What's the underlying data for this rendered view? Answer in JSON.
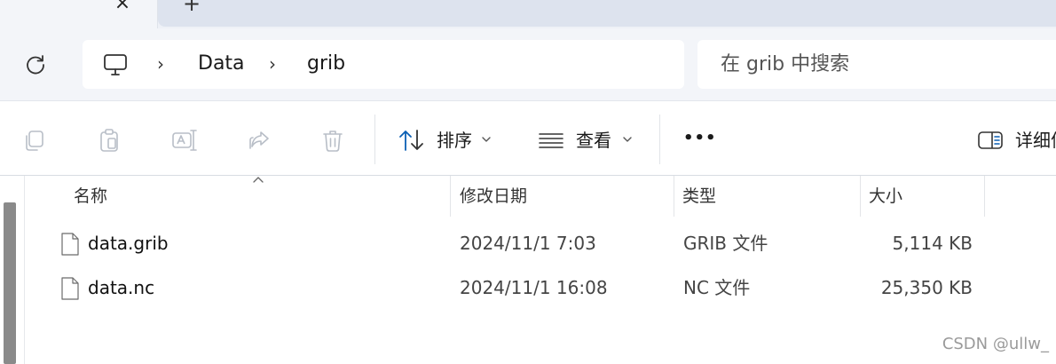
{
  "tabs": {
    "close_glyph": "×",
    "new_tab_glyph": "+"
  },
  "address_bar": {
    "breadcrumbs": [
      {
        "label": "Data"
      },
      {
        "label": "grib"
      }
    ],
    "separator_glyph": "›"
  },
  "search": {
    "placeholder": "在 grib 中搜索"
  },
  "toolbar": {
    "sort_label": "排序",
    "view_label": "查看",
    "more_label": "•••",
    "details_label": "详细信"
  },
  "columns": {
    "name": "名称",
    "date_modified": "修改日期",
    "type": "类型",
    "size": "大小"
  },
  "files": [
    {
      "name": "data.grib",
      "date": "2024/11/1 7:03",
      "type": "GRIB 文件",
      "size": "5,114 KB"
    },
    {
      "name": "data.nc",
      "date": "2024/11/1 16:08",
      "type": "NC 文件",
      "size": "25,350 KB"
    }
  ],
  "watermark": "CSDN @ullw_",
  "colors": {
    "accent": "#0a5fb4",
    "icon_gray": "#b8bec7",
    "chrome_bg": "#f3f5f9"
  },
  "icons": {
    "toolbar": [
      "copy-icon",
      "paste-icon",
      "rename-icon",
      "share-icon",
      "delete-icon",
      "sort-icon",
      "view-icon",
      "more-icon",
      "details-pane-icon"
    ],
    "address": [
      "refresh-icon",
      "this-pc-icon"
    ],
    "files": [
      "file-icon"
    ]
  }
}
